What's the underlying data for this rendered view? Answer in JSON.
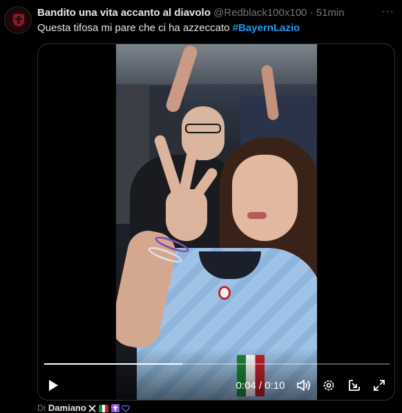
{
  "author": {
    "name": "Bandito una vita accanto al diavolo",
    "handle": "@Redblack100x100",
    "separator": "·",
    "time": "51min"
  },
  "more_label": "···",
  "tweet": {
    "text": "Questa tifosa  mi pare che ci ha azzeccato ",
    "hashtag": "#BayernLazio"
  },
  "video": {
    "current_time": "0:04",
    "duration": "0:10",
    "time_display": "0:04 / 0:10",
    "progress": 0.4
  },
  "footer": {
    "prefix": "Di",
    "name": "Damiano",
    "badges": [
      "x-logo-icon",
      "italy-flag-icon",
      "latin-cross-icon",
      "blue-heart-icon"
    ]
  },
  "colors": {
    "accent": "#1d9bf0",
    "background": "#000000",
    "text": "#e7e9ea",
    "muted": "#71767b"
  }
}
